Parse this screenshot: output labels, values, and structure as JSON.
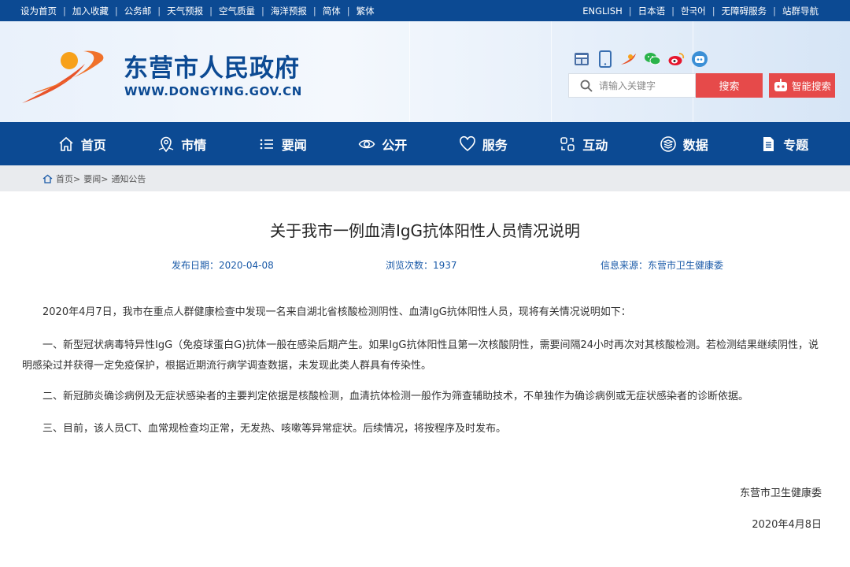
{
  "topbar": {
    "left_links": [
      "设为首页",
      "加入收藏",
      "公务邮",
      "天气预报",
      "空气质量",
      "海洋预报",
      "简体",
      "繁体"
    ],
    "right_links": [
      "ENGLISH",
      "日本语",
      "한국어",
      "无障碍服务",
      "站群导航"
    ]
  },
  "header": {
    "site_name": "东营市人民政府",
    "site_url": "WWW.DONGYING.GOV.CN",
    "social_icons": [
      "gov-app-icon",
      "mobile-icon",
      "toutiao-icon",
      "wechat-icon",
      "weibo-icon",
      "robot-service-icon"
    ],
    "search_placeholder": "请输入关键字",
    "search_label": "搜索",
    "smart_search_label": "智能搜索"
  },
  "nav": {
    "items": [
      {
        "label": "首页",
        "icon": "home-icon"
      },
      {
        "label": "市情",
        "icon": "map-pin-icon"
      },
      {
        "label": "要闻",
        "icon": "list-icon"
      },
      {
        "label": "公开",
        "icon": "eye-icon"
      },
      {
        "label": "服务",
        "icon": "heart-icon"
      },
      {
        "label": "互动",
        "icon": "interaction-icon"
      },
      {
        "label": "数据",
        "icon": "database-icon"
      },
      {
        "label": "专题",
        "icon": "document-icon"
      }
    ]
  },
  "breadcrumb": {
    "items": [
      "首页>",
      "要闻>",
      "通知公告"
    ]
  },
  "article": {
    "title": "关于我市一例血清IgG抗体阳性人员情况说明",
    "publish_date": "发布日期：2020-04-08",
    "views": "浏览次数：1937",
    "source": "信息来源：东营市卫生健康委",
    "paragraphs": [
      "2020年4月7日，我市在重点人群健康检查中发现一名来自湖北省核酸检测阴性、血清IgG抗体阳性人员，现将有关情况说明如下：",
      "一、新型冠状病毒特异性IgG（免疫球蛋白G)抗体一般在感染后期产生。如果IgG抗体阳性且第一次核酸阴性，需要间隔24小时再次对其核酸检测。若检测结果继续阴性，说明感染过并获得一定免疫保护，根据近期流行病学调查数据，未发现此类人群具有传染性。",
      "二、新冠肺炎确诊病例及无症状感染者的主要判定依据是核酸检测，血清抗体检测一般作为筛查辅助技术，不单独作为确诊病例或无症状感染者的诊断依据。",
      "三、目前，该人员CT、血常规检查均正常，无发热、咳嗽等异常症状。后续情况，将按程序及时发布。"
    ],
    "signature": "东营市卫生健康委",
    "sign_date": "2020年4月8日"
  },
  "colors": {
    "brand_blue": "#0c4a93",
    "search_red": "#e64a4a",
    "meta_blue": "#1a5aa8"
  }
}
